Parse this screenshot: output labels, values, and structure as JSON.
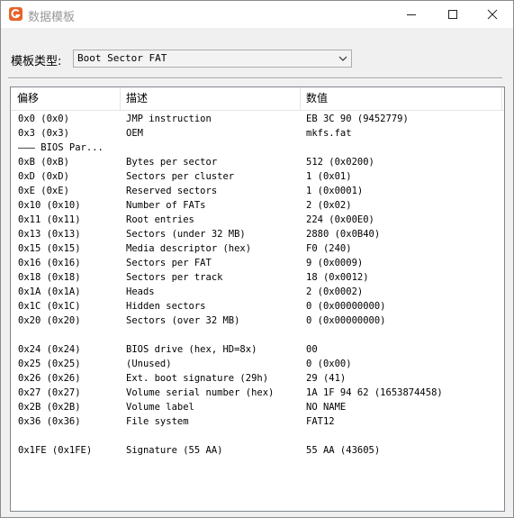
{
  "window": {
    "title": "数据模板",
    "icon": "app-logo-icon",
    "accent": "#e8632b"
  },
  "template": {
    "label": "模板类型:",
    "selected": "Boot Sector FAT"
  },
  "table": {
    "headers": [
      "偏移",
      "描述",
      "数值"
    ],
    "rows": [
      {
        "offset": "0x0 (0x0)",
        "desc": "JMP instruction",
        "value": "EB 3C 90 (9452779)"
      },
      {
        "offset": "0x3 (0x3)",
        "desc": "OEM",
        "value": "mkfs.fat"
      },
      {
        "offset": "——— BIOS Par...",
        "desc": "",
        "value": ""
      },
      {
        "offset": "0xB (0xB)",
        "desc": "Bytes per sector",
        "value": "512 (0x0200)"
      },
      {
        "offset": "0xD (0xD)",
        "desc": "Sectors per cluster",
        "value": "1 (0x01)"
      },
      {
        "offset": "0xE (0xE)",
        "desc": "Reserved sectors",
        "value": "1 (0x0001)"
      },
      {
        "offset": "0x10 (0x10)",
        "desc": "Number of FATs",
        "value": "2 (0x02)"
      },
      {
        "offset": "0x11 (0x11)",
        "desc": "Root entries",
        "value": "224 (0x00E0)"
      },
      {
        "offset": "0x13 (0x13)",
        "desc": "Sectors (under 32 MB)",
        "value": "2880 (0x0B40)"
      },
      {
        "offset": "0x15 (0x15)",
        "desc": "Media descriptor (hex)",
        "value": "F0 (240)"
      },
      {
        "offset": "0x16 (0x16)",
        "desc": "Sectors per FAT",
        "value": "9 (0x0009)"
      },
      {
        "offset": "0x18 (0x18)",
        "desc": "Sectors per track",
        "value": "18 (0x0012)"
      },
      {
        "offset": "0x1A (0x1A)",
        "desc": "Heads",
        "value": "2 (0x0002)"
      },
      {
        "offset": "0x1C (0x1C)",
        "desc": "Hidden sectors",
        "value": "0 (0x00000000)"
      },
      {
        "offset": "0x20 (0x20)",
        "desc": "Sectors (over 32 MB)",
        "value": "0 (0x00000000)"
      },
      {
        "offset": "",
        "desc": "",
        "value": ""
      },
      {
        "offset": "0x24 (0x24)",
        "desc": "BIOS drive (hex, HD=8x)",
        "value": "00"
      },
      {
        "offset": "0x25 (0x25)",
        "desc": "(Unused)",
        "value": "0 (0x00)"
      },
      {
        "offset": "0x26 (0x26)",
        "desc": "Ext. boot signature (29h)",
        "value": "29 (41)"
      },
      {
        "offset": "0x27 (0x27)",
        "desc": "Volume serial number (hex)",
        "value": "1A 1F 94 62 (1653874458)"
      },
      {
        "offset": "0x2B (0x2B)",
        "desc": "Volume label",
        "value": "NO NAME"
      },
      {
        "offset": "0x36 (0x36)",
        "desc": "File system",
        "value": "FAT12"
      },
      {
        "offset": "",
        "desc": "",
        "value": ""
      },
      {
        "offset": "0x1FE (0x1FE)",
        "desc": "Signature (55 AA)",
        "value": "55 AA (43605)"
      }
    ]
  }
}
